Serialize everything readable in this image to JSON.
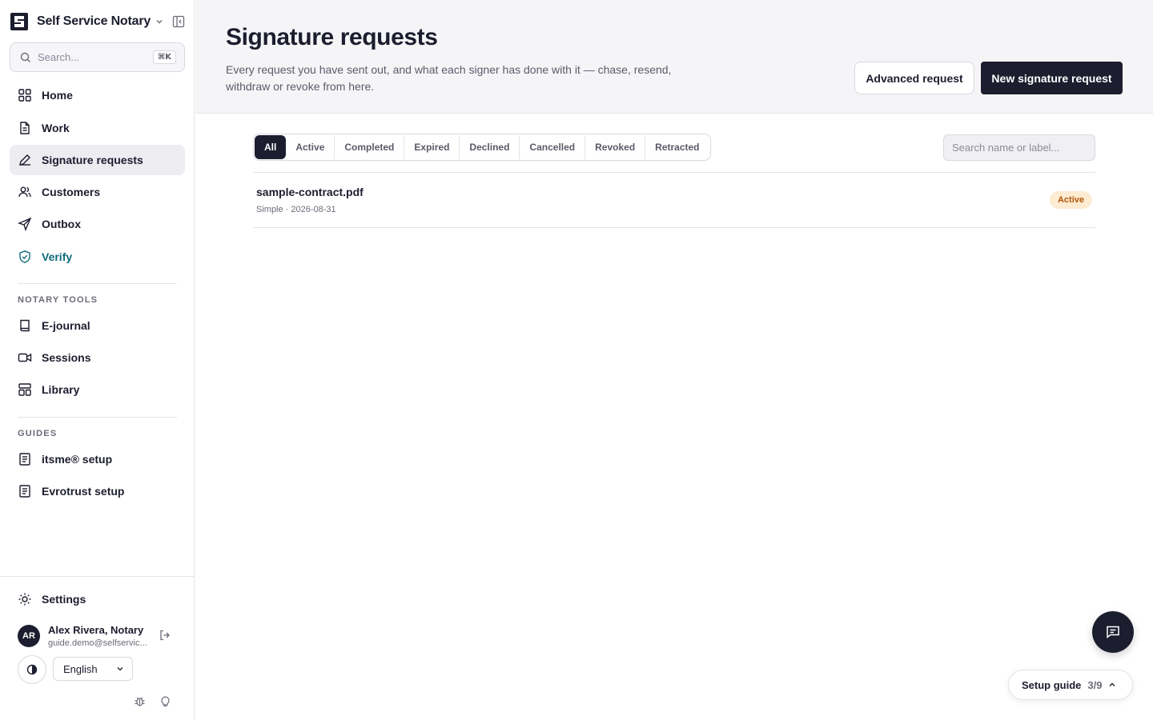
{
  "brand": {
    "name": "Self Service Notary"
  },
  "search": {
    "placeholder": "Search...",
    "shortcut": "⌘K"
  },
  "nav": {
    "home": "Home",
    "work": "Work",
    "signature_requests": "Signature requests",
    "customers": "Customers",
    "outbox": "Outbox",
    "verify": "Verify"
  },
  "notary_tools": {
    "heading": "NOTARY TOOLS",
    "ejournal": "E-journal",
    "sessions": "Sessions",
    "library": "Library"
  },
  "guides": {
    "heading": "GUIDES",
    "itsme": "itsme® setup",
    "evrotrust": "Evrotrust setup"
  },
  "footer": {
    "settings": "Settings",
    "user_name": "Alex Rivera, Notary",
    "user_email": "guide.demo@selfservic...",
    "avatar_initials": "AR",
    "language": "English"
  },
  "header": {
    "title": "Signature requests",
    "description": "Every request you have sent out, and what each signer has done with it — chase, resend, withdraw or revoke from here.",
    "advanced_button": "Advanced request",
    "new_button": "New signature request"
  },
  "filters": {
    "all": "All",
    "active": "Active",
    "completed": "Completed",
    "expired": "Expired",
    "declined": "Declined",
    "cancelled": "Cancelled",
    "revoked": "Revoked",
    "retracted": "Retracted",
    "search_placeholder": "Search name or label..."
  },
  "requests": [
    {
      "name": "sample-contract.pdf",
      "meta": "Simple · 2026-08-31",
      "status": "Active"
    }
  ],
  "setup_guide": {
    "label": "Setup guide",
    "progress": "3/9"
  },
  "colors": {
    "primary": "#1c1d2e",
    "verify": "#0e6b7a",
    "badge_bg": "#fdecd2",
    "badge_text": "#b0560a"
  }
}
